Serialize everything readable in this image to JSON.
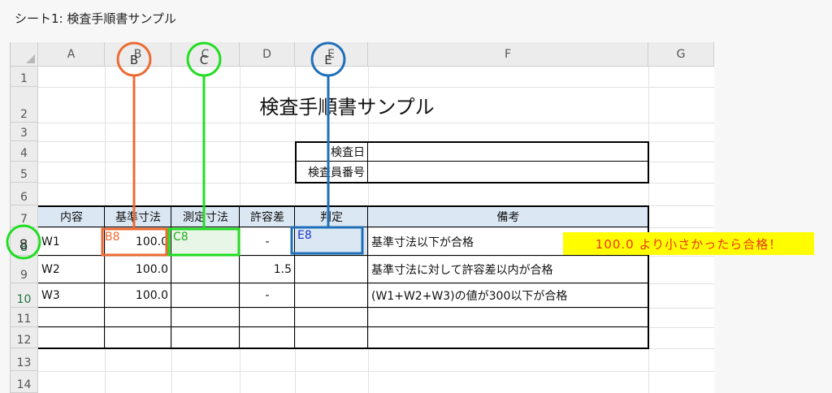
{
  "caption": "シート1: 検査手順書サンプル",
  "columns": [
    "A",
    "B",
    "C",
    "D",
    "E",
    "F",
    "G"
  ],
  "rows": [
    "1",
    "2",
    "3",
    "4",
    "5",
    "6",
    "7",
    "8",
    "9",
    "10",
    "11",
    "12",
    "13",
    "14"
  ],
  "title": "検査手順書サンプル",
  "info": {
    "date_label": "検査日",
    "inspector_label": "検査員番号"
  },
  "table": {
    "headers": [
      "内容",
      "基準寸法",
      "測定寸法",
      "許容差",
      "判定",
      "備考"
    ],
    "rows": [
      {
        "item": "W1",
        "standard": "100.0",
        "measured": "",
        "tolerance": "-",
        "judgement": "",
        "remarks": "基準寸法以下が合格"
      },
      {
        "item": "W2",
        "standard": "100.0",
        "measured": "",
        "tolerance": "1.5",
        "judgement": "",
        "remarks": "基準寸法に対して許容差以内が合格"
      },
      {
        "item": "W3",
        "standard": "100.0",
        "measured": "",
        "tolerance": "-",
        "judgement": "",
        "remarks": "(W1+W2+W3)の値が300以下が合格"
      }
    ]
  },
  "annotations": {
    "cell_b8": "B8",
    "cell_c8": "C8",
    "cell_e8": "E8",
    "circle_b": "B",
    "circle_c": "C",
    "circle_e": "E",
    "circle_row8": "8",
    "note": "100.0 より小さかったら合格！"
  },
  "colors": {
    "orange": "#ed6b33",
    "green": "#22dd22",
    "blue": "#1f6fb8",
    "note_bg": "#fffd00",
    "note_text": "#e8380d",
    "header_fill": "#dbe8f4"
  }
}
